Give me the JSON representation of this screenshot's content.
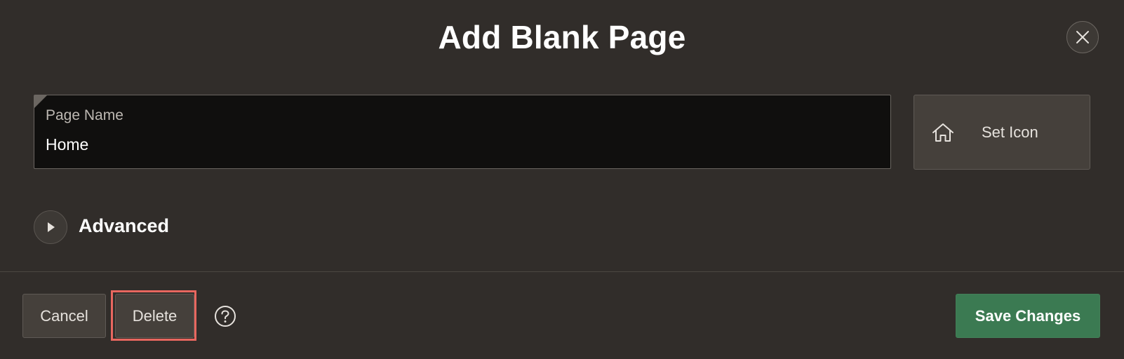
{
  "dialog": {
    "title": "Add Blank Page"
  },
  "form": {
    "page_name": {
      "label": "Page Name",
      "value": "Home"
    },
    "set_icon": {
      "label": "Set Icon",
      "icon": "home-icon"
    },
    "advanced": {
      "label": "Advanced",
      "icon": "play-triangle-icon",
      "expanded": false
    }
  },
  "footer": {
    "cancel_label": "Cancel",
    "delete_label": "Delete",
    "help_icon": "help-circle-icon",
    "save_label": "Save Changes"
  },
  "colors": {
    "background": "#312d2a",
    "field_background": "#100f0e",
    "save_button": "#3b7a52",
    "highlight": "#e8675f"
  }
}
